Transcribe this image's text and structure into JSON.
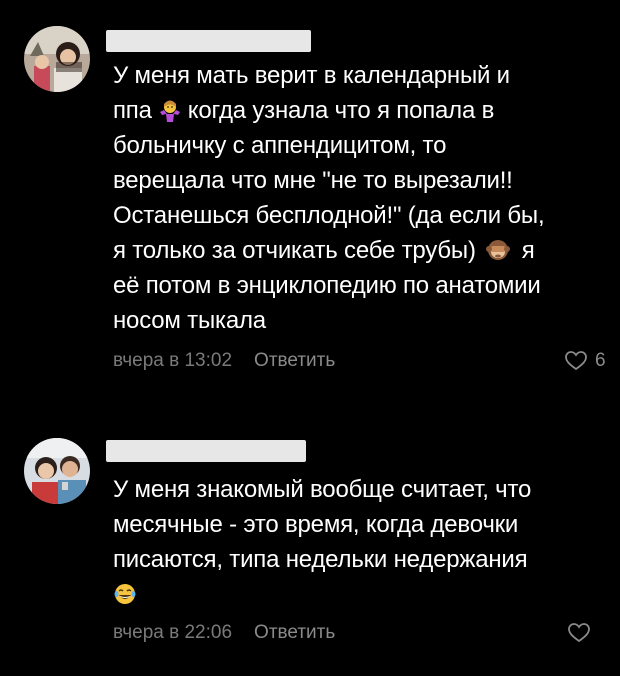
{
  "comments": [
    {
      "text_lines": [
        "У меня мать верит в календарный и",
        "ппа",
        "когда узнала что я попала в",
        "больничку с аппендицитом, то",
        "верещала что мне \"не то вырезали!!",
        "Останешься бесплодной!\" (да если бы,",
        "я только за отчикать себе трубы)",
        "я",
        "её потом в энциклопедию по анатомии",
        "носом тыкала"
      ],
      "emoji_1": "shrugging-woman-emoji",
      "emoji_2": "see-no-evil-monkey-emoji",
      "time": "вчера в 13:02",
      "reply_label": "Ответить",
      "likes": "6"
    },
    {
      "text_lines": [
        "У меня знакомый вообще считает, что",
        "месячные - это время,  когда девочки",
        "писаются, типа недельки недержания"
      ],
      "emoji_1": "face-with-tears-of-joy-emoji",
      "time": "вчера в 22:06",
      "reply_label": "Ответить",
      "likes": ""
    }
  ],
  "icons": {
    "like": "heart-outline-icon"
  },
  "colors": {
    "background": "#000000",
    "text": "#ffffff",
    "meta": "#7a7a7a",
    "name_redaction": "#e7e7e7"
  }
}
